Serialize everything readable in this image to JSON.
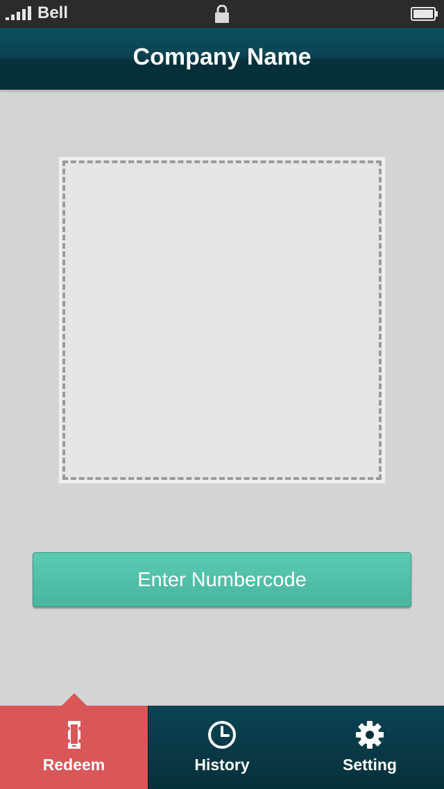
{
  "status_bar": {
    "carrier": "Bell",
    "icons": [
      "signal-icon",
      "lock-icon",
      "battery-icon"
    ]
  },
  "header": {
    "title": "Company Name"
  },
  "scan_area": {
    "icon": "none"
  },
  "actions": {
    "enter_numbercode_label": "Enter Numbercode"
  },
  "tab_bar": {
    "items": [
      {
        "label": "Redeem",
        "icon": "phone-ticket-icon",
        "active": true
      },
      {
        "label": "History",
        "icon": "clock-icon",
        "active": false
      },
      {
        "label": "Setting",
        "icon": "gear-icon",
        "active": false
      }
    ]
  },
  "colors": {
    "status_bar_bg": "#2b2b2b",
    "nav_bar_bg": "#0a4452",
    "content_bg": "#d4d4d4",
    "button_bg": "#52c1a9",
    "tab_active_bg": "#d95759",
    "tab_bar_bg": "#06303a"
  }
}
